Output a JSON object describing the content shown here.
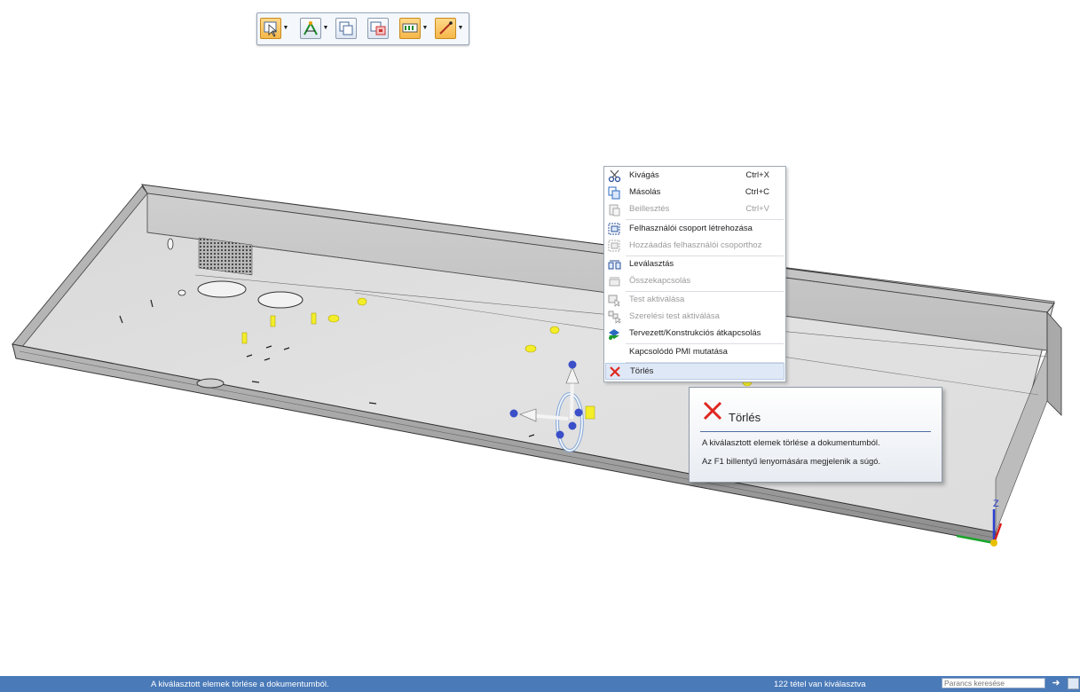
{
  "toolbar": {
    "buttons": [
      {
        "name": "select-tool-button",
        "icon": "select-arrow-icon",
        "dropdown": true,
        "active": true
      },
      {
        "name": "relate-tool-button",
        "icon": "relate-icon",
        "dropdown": true,
        "active": false
      },
      {
        "name": "copy-tool-button",
        "icon": "copy-body-icon",
        "dropdown": false,
        "active": false
      },
      {
        "name": "move-tool-button",
        "icon": "move-body-icon",
        "dropdown": false,
        "active": false
      },
      {
        "name": "pattern-tool-button",
        "icon": "pattern-icon",
        "dropdown": true,
        "active": false
      },
      {
        "name": "sketch-tool-button",
        "icon": "line-sketch-icon",
        "dropdown": true,
        "active": true
      }
    ]
  },
  "context_menu": {
    "items": [
      {
        "label": "Kivágás",
        "shortcut": "Ctrl+X",
        "icon": "scissors-icon",
        "disabled": false
      },
      {
        "label": "Másolás",
        "shortcut": "Ctrl+C",
        "icon": "copy-icon",
        "disabled": false
      },
      {
        "label": "Beillesztés",
        "shortcut": "Ctrl+V",
        "icon": "paste-icon",
        "disabled": true
      },
      {
        "label": "Felhasználói csoport létrehozása",
        "shortcut": "",
        "icon": "create-group-icon",
        "disabled": false
      },
      {
        "label": "Hozzáadás felhasználói csoporthoz",
        "shortcut": "",
        "icon": "add-to-group-icon",
        "disabled": true
      },
      {
        "label": "Leválasztás",
        "shortcut": "",
        "icon": "detach-icon",
        "disabled": false
      },
      {
        "label": "Összekapcsolás",
        "shortcut": "",
        "icon": "attach-icon",
        "disabled": true
      },
      {
        "label": "Test aktiválása",
        "shortcut": "",
        "icon": "activate-body-icon",
        "disabled": true
      },
      {
        "label": "Szerelési test aktiválása",
        "shortcut": "",
        "icon": "activate-assembly-body-icon",
        "disabled": true
      },
      {
        "label": "Tervezett/Konstrukciós átkapcsolás",
        "shortcut": "",
        "icon": "design-construction-toggle-icon",
        "disabled": false
      },
      {
        "label": "Kapcsolódó PMI mutatása",
        "shortcut": "",
        "icon": "",
        "disabled": false
      },
      {
        "label": "Törlés",
        "shortcut": "",
        "icon": "delete-icon",
        "disabled": false,
        "highlighted": true
      }
    ]
  },
  "tooltip": {
    "title": "Törlés",
    "description": "A kiválasztott elemek törlése a dokumentumból.",
    "help": "Az F1 billentyű lenyomására megjelenik a súgó."
  },
  "status_bar": {
    "message": "A kiválasztott elemek törlése a dokumentumból.",
    "selection": "122 tétel van kiválasztva",
    "search_placeholder": "Parancs keresése"
  },
  "triad": {
    "z_label": "Z"
  },
  "colors": {
    "status_bar": "#4a7ab8",
    "delete_red": "#e0261f",
    "highlight": "#dfe8f6",
    "selection_yellow": "#f4ee2a",
    "handle_blue": "#3a4fc8"
  }
}
